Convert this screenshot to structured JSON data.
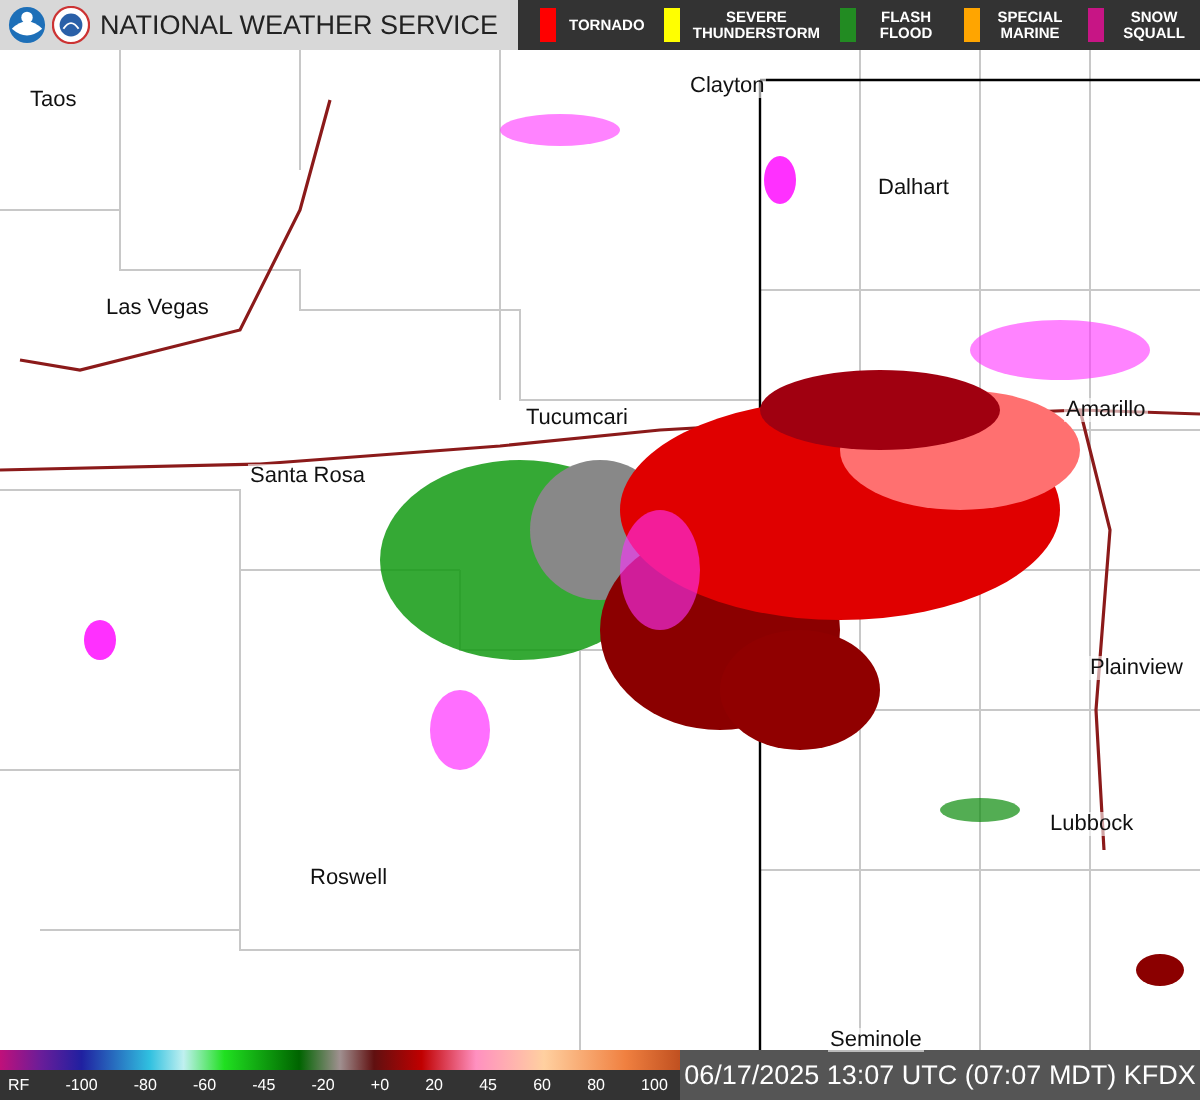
{
  "header": {
    "title": "NATIONAL WEATHER SERVICE"
  },
  "warnings": [
    {
      "label": "TORNADO",
      "color": "#ff0000"
    },
    {
      "label": "SEVERE THUNDERSTORM",
      "color": "#ffff00"
    },
    {
      "label": "FLASH FLOOD",
      "color": "#228b22"
    },
    {
      "label": "SPECIAL MARINE",
      "color": "#ffa500"
    },
    {
      "label": "SNOW SQUALL",
      "color": "#c71585"
    }
  ],
  "cities": [
    "Taos",
    "Clayton",
    "Dalhart",
    "Las Vegas",
    "Amarillo",
    "Tucumcari",
    "Santa Rosa",
    "Plainview",
    "Lubbock",
    "Roswell",
    "Seminole"
  ],
  "scale": {
    "unit": "RF",
    "ticks": [
      "-100",
      "-80",
      "-60",
      "-45",
      "-20",
      "+0",
      "20",
      "45",
      "60",
      "80",
      "100"
    ]
  },
  "timestamp": "06/17/2025 13:07 UTC (07:07 MDT) KFDX"
}
